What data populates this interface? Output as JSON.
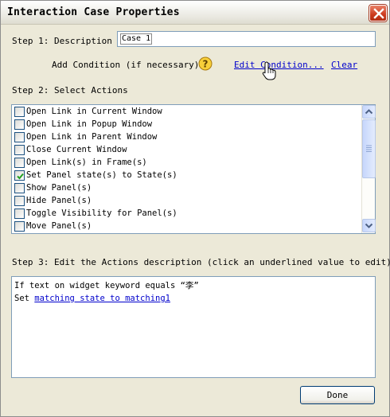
{
  "window": {
    "title": "Interaction Case Properties"
  },
  "step1": {
    "label": "Step 1: Description",
    "description_value": "Case 1",
    "add_condition_label": "Add Condition (if necessary)",
    "edit_condition_link": "Edit Condition...",
    "clear_link": "Clear"
  },
  "step2": {
    "label": "Step 2: Select Actions",
    "actions": [
      {
        "label": "Open Link in Current Window",
        "checked": false
      },
      {
        "label": "Open Link in Popup Window",
        "checked": false
      },
      {
        "label": "Open Link in Parent Window",
        "checked": false
      },
      {
        "label": "Close Current Window",
        "checked": false
      },
      {
        "label": "Open Link(s) in Frame(s)",
        "checked": false
      },
      {
        "label": "Set Panel state(s) to State(s)",
        "checked": true
      },
      {
        "label": "Show Panel(s)",
        "checked": false
      },
      {
        "label": "Hide Panel(s)",
        "checked": false
      },
      {
        "label": "Toggle Visibility for Panel(s)",
        "checked": false
      },
      {
        "label": "Move Panel(s)",
        "checked": false
      }
    ]
  },
  "step3": {
    "label": "Step 3: Edit the Actions description (click an underlined value to edit):",
    "line1": "If text on widget keyword equals “李”",
    "line2_prefix": "Set ",
    "line2_link": "matching state to matching1"
  },
  "buttons": {
    "done": "Done"
  },
  "colors": {
    "link": "#0000cc",
    "check": "#21a121",
    "close_button": "#cc3a1d"
  },
  "icons": {
    "help": "help-question-icon",
    "close": "close-icon",
    "cursor": "hand-pointer-cursor-icon"
  }
}
